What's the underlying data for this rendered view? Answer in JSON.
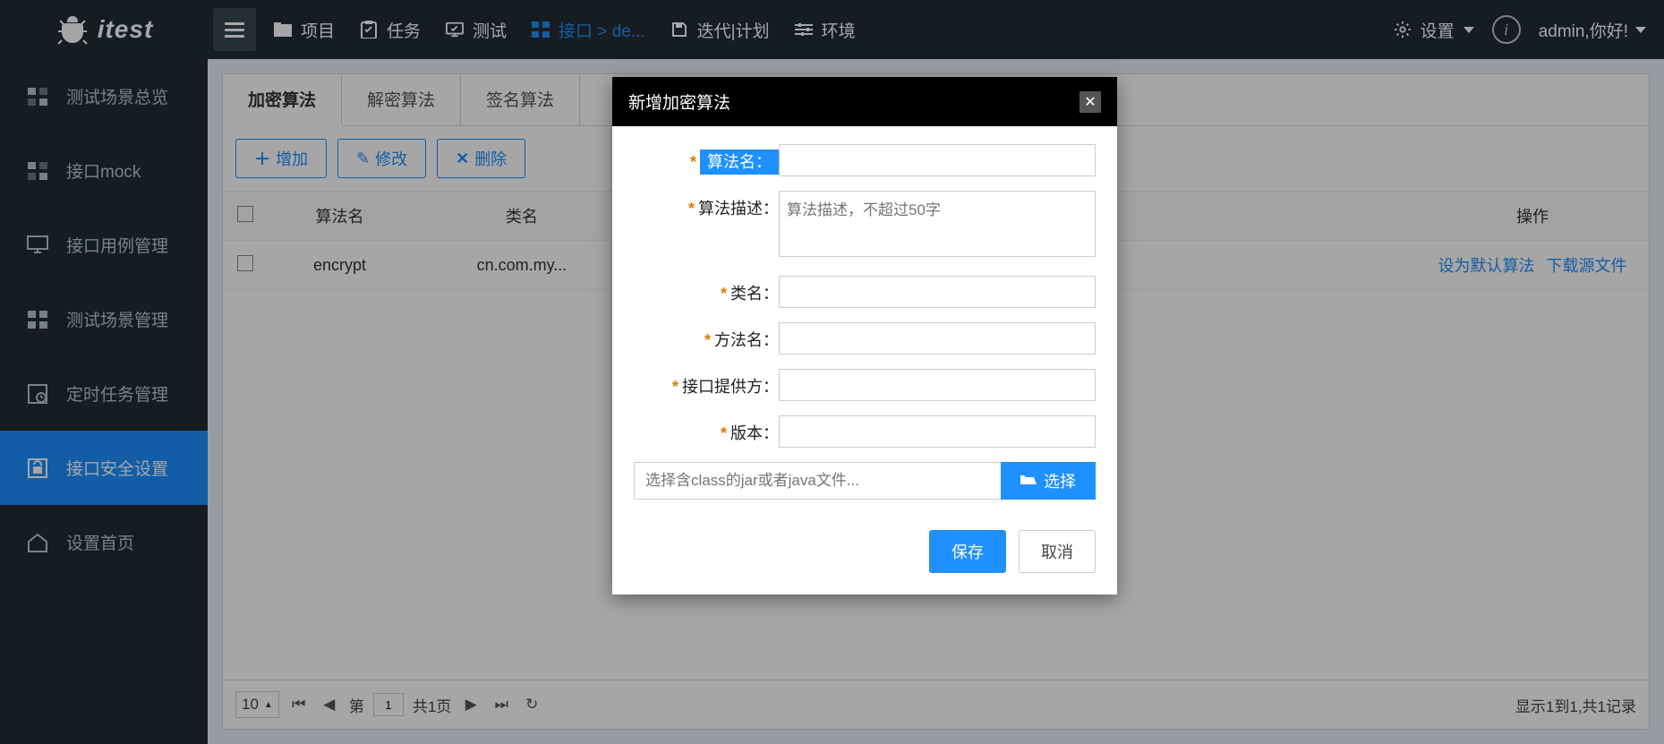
{
  "logo_text": "itest",
  "nav": {
    "items": [
      {
        "label": "项目"
      },
      {
        "label": "任务"
      },
      {
        "label": "测试"
      },
      {
        "label": "接口 > de..."
      },
      {
        "label": "迭代|计划"
      },
      {
        "label": "环境"
      }
    ],
    "settings": "设置",
    "user": "admin,你好!"
  },
  "sidebar": {
    "items": [
      {
        "label": "测试场景总览"
      },
      {
        "label": "接口mock"
      },
      {
        "label": "接口用例管理"
      },
      {
        "label": "测试场景管理"
      },
      {
        "label": "定时任务管理"
      },
      {
        "label": "接口安全设置"
      },
      {
        "label": "设置首页"
      }
    ]
  },
  "tabs": [
    {
      "label": "加密算法",
      "active": true
    },
    {
      "label": "解密算法"
    },
    {
      "label": "签名算法"
    }
  ],
  "toolbar": {
    "add": "增加",
    "edit": "修改",
    "del": "删除"
  },
  "table": {
    "headers": {
      "name": "算法名",
      "cls": "类名",
      "op": "操作"
    },
    "rows": [
      {
        "name": "encrypt",
        "cls": "cn.com.my...",
        "op_default": "设为默认算法",
        "op_download": "下载源文件"
      }
    ]
  },
  "pager": {
    "size": "10",
    "page_prefix": "第",
    "page_value": "1",
    "total_pages": "共1页",
    "summary": "显示1到1,共1记录"
  },
  "dialog": {
    "title": "新增加密算法",
    "fields": {
      "name": "算法名：",
      "desc": "算法描述：",
      "desc_placeholder": "算法描述，不超过50字",
      "cls": "类名：",
      "method": "方法名：",
      "provider": "接口提供方：",
      "version": "版本："
    },
    "file_placeholder": "选择含class的jar或者java文件...",
    "file_btn": "选择",
    "save": "保存",
    "cancel": "取消"
  }
}
